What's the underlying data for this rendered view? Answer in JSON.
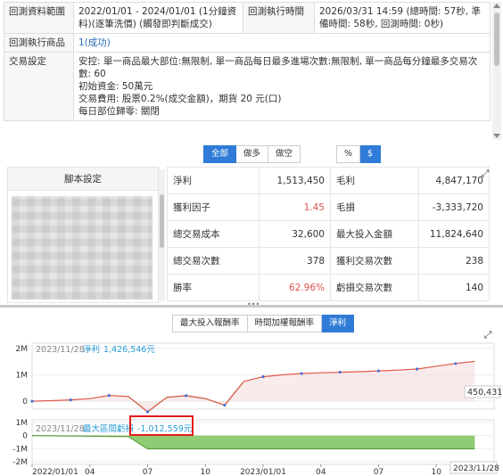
{
  "info": {
    "range_label": "回測資料範圍",
    "range_value": "2022/01/01 - 2024/01/01 (1分鐘資料)(逐筆洗價) (觸發即判斷成交)",
    "exec_time_label": "回測執行時間",
    "exec_time_value": "2026/03/31 14:59 (總時間: 57秒, 準備時間: 58秒, 回測時間: 0秒)",
    "product_label": "回測執行商品",
    "product_value": "1(成功)",
    "settings_label": "交易設定",
    "settings_line1": "安控: 單一商品最大部位:無限制, 單一商品每日最多進場次數:無限制, 單一商品每分鐘最多交易次數: 60",
    "settings_line2": "初始資金: 50萬元",
    "settings_line3": "交易費用: 股票0.2%(成交金額)，期貨 20 元(口)",
    "settings_line4": "每日部位歸零: 關閉"
  },
  "direction_tabs": [
    "全部",
    "做多",
    "做空"
  ],
  "direction_active": 0,
  "unit_tabs": [
    "%",
    "$"
  ],
  "unit_active": 1,
  "script_panel": {
    "title": "腳本設定"
  },
  "stats": [
    {
      "l1": "淨利",
      "v1": "1,513,450",
      "l2": "毛利",
      "v2": "4,847,170"
    },
    {
      "l1": "獲利因子",
      "v1": "1.45",
      "l2": "毛損",
      "v2": "-3,333,720"
    },
    {
      "l1": "總交易成本",
      "v1": "32,600",
      "l2": "最大投入金額",
      "v2": "11,824,640"
    },
    {
      "l1": "總交易次數",
      "v1": "378",
      "l2": "獲利交易次數",
      "v2": "238"
    },
    {
      "l1": "勝率",
      "v1": "62.96%",
      "l2": "虧損交易次數",
      "v2": "140"
    }
  ],
  "chart_tabs": [
    "最大投入報酬率",
    "時間加權報酬率",
    "淨利"
  ],
  "chart_tab_active": 2,
  "colors": {
    "accent": "#2f7bd7",
    "profit_line": "#4a6fd8",
    "loss_line": "#e05a4a",
    "drawdown": "#6ab04c",
    "highlight": "#e31a1a"
  },
  "chart_data": {
    "type": "line",
    "top_panel": {
      "legend_date": "2023/11/28",
      "legend_label": "淨利",
      "legend_value": "1,426,546元",
      "last_value_label": "450,431",
      "yticks": [
        "2M",
        "1M",
        "0"
      ],
      "ylim": [
        -300000,
        2200000
      ],
      "series": {
        "name": "淨利",
        "x": [
          "2022-01",
          "2022-02",
          "2022-03",
          "2022-04",
          "2022-05",
          "2022-06",
          "2022-07",
          "2022-08",
          "2022-09",
          "2022-10",
          "2022-11",
          "2022-12",
          "2023-01",
          "2023-02",
          "2023-03",
          "2023-04",
          "2023-05",
          "2023-06",
          "2023-07",
          "2023-08",
          "2023-09",
          "2023-10",
          "2023-11",
          "2023-12"
        ],
        "values": [
          0,
          20000,
          50000,
          100000,
          220000,
          180000,
          -400000,
          150000,
          210000,
          100000,
          -150000,
          750000,
          930000,
          1000000,
          1050000,
          1080000,
          1100000,
          1120000,
          1150000,
          1180000,
          1220000,
          1330000,
          1430000,
          1510000
        ]
      }
    },
    "bottom_panel": {
      "legend_date": "2023/11/28",
      "legend_label": "最大區間虧損",
      "legend_value": "-1,012,559元",
      "yticks": [
        "1M",
        "0",
        "-1M",
        "-2M"
      ],
      "ylim": [
        -2200000,
        1200000
      ],
      "series": {
        "name": "最大區間虧損",
        "x": [
          "2022-01",
          "2022-06",
          "2022-07",
          "2023-12"
        ],
        "values": [
          0,
          -80000,
          -1012559,
          -1012559
        ]
      }
    },
    "xticks": [
      "2022/01/01",
      "04",
      "07",
      "10",
      "2023/01/01",
      "04",
      "07",
      "10"
    ],
    "x_end_label": "2023/11/28"
  }
}
